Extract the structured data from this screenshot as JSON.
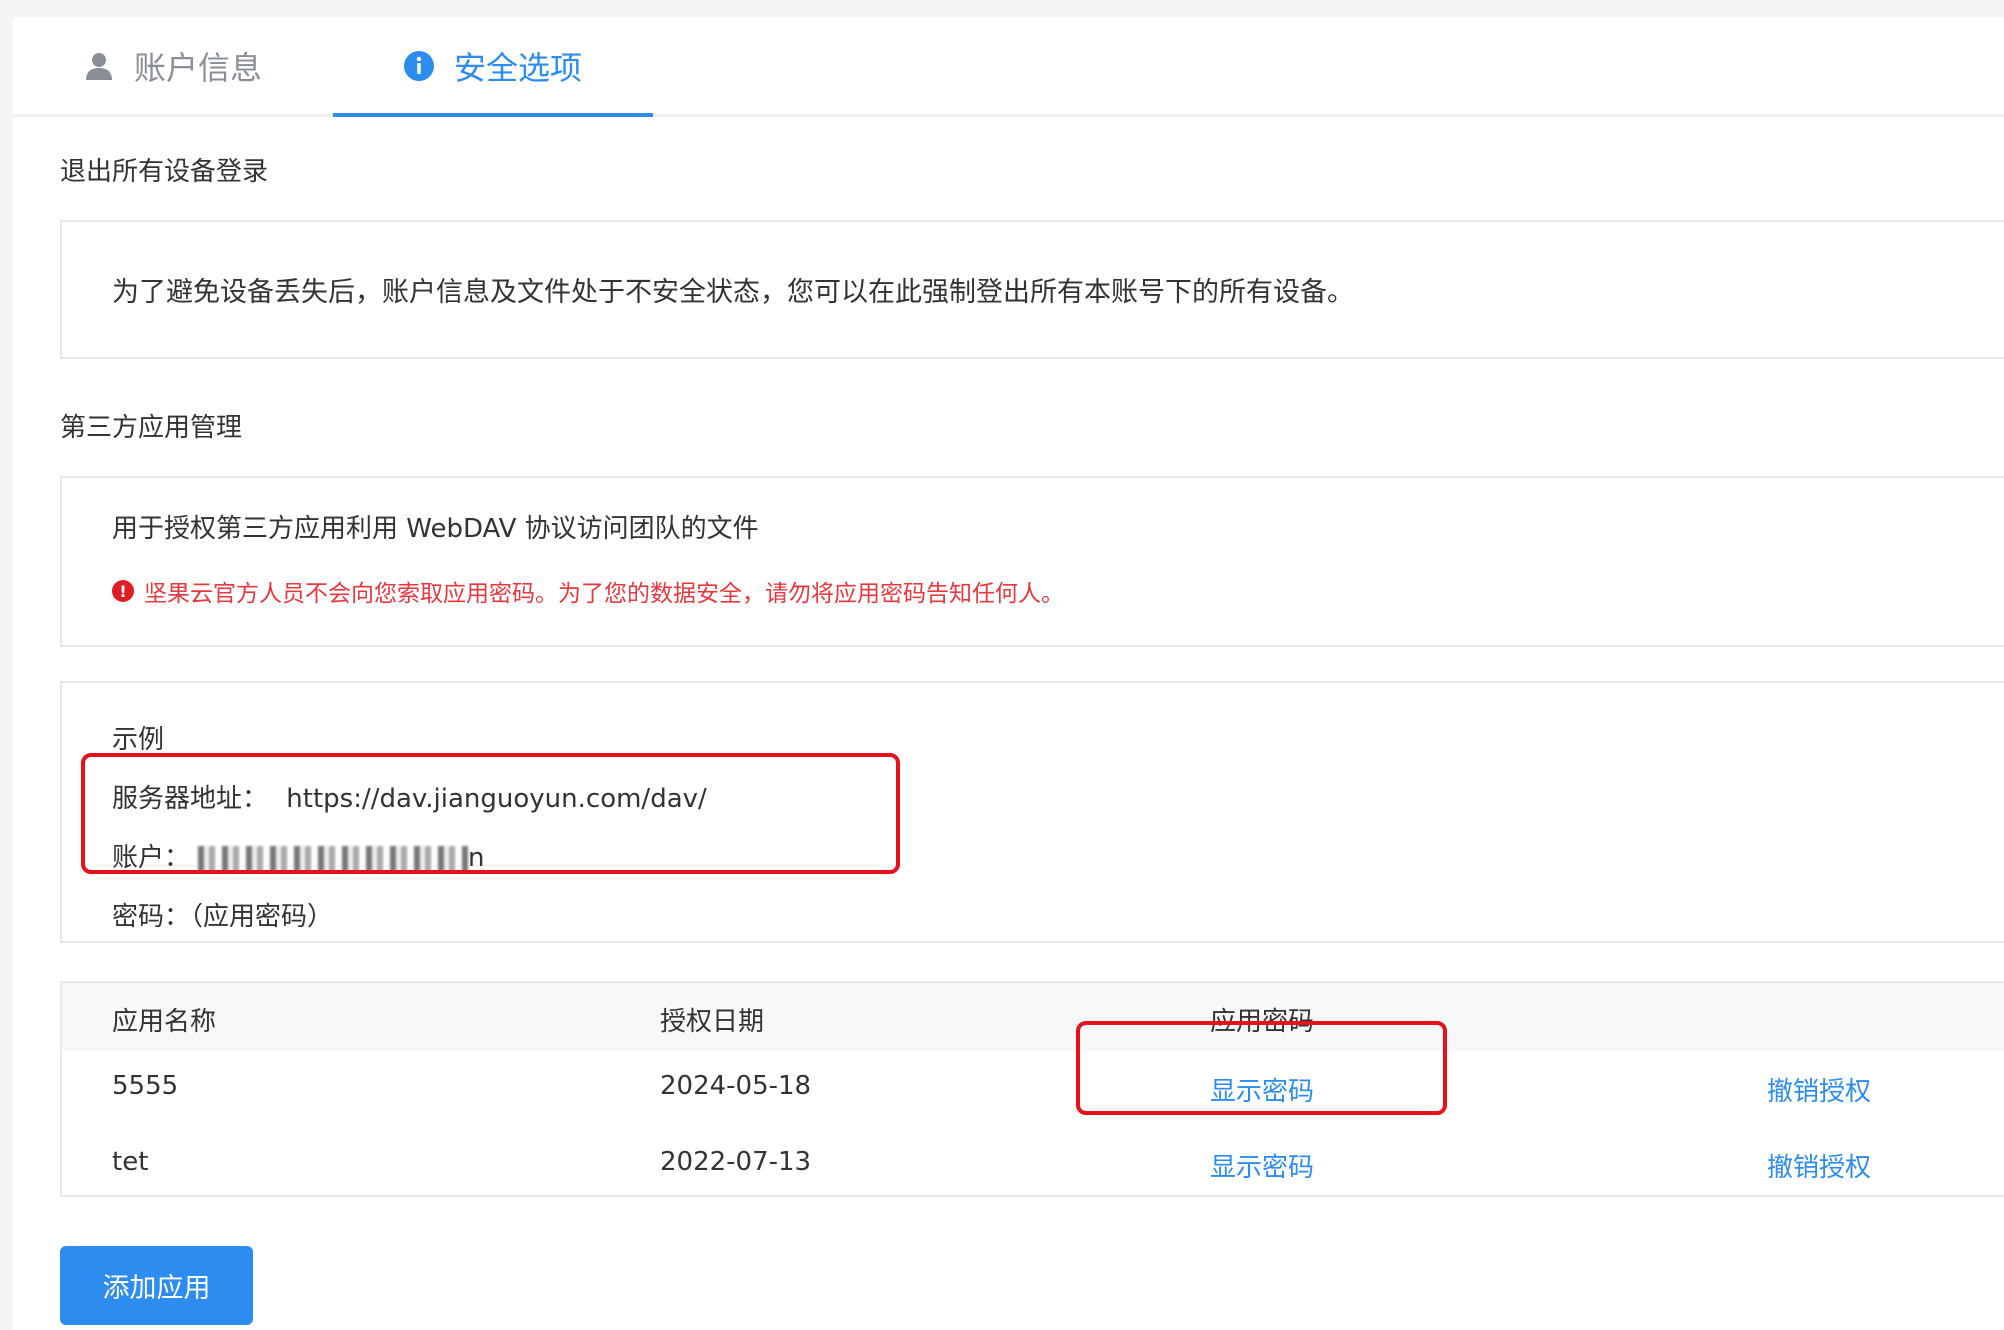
{
  "tabs": {
    "account": {
      "label": "账户信息",
      "icon": "user-icon"
    },
    "security": {
      "label": "安全选项",
      "icon": "info-icon",
      "active": true
    }
  },
  "logout_section": {
    "title": "退出所有设备登录",
    "description": "为了避免设备丢失后，账户信息及文件处于不安全状态，您可以在此强制登出所有本账号下的所有设备。"
  },
  "third_party": {
    "title": "第三方应用管理",
    "description": "用于授权第三方应用利用 WebDAV 协议访问团队的文件",
    "warning": "坚果云官方人员不会向您索取应用密码。为了您的数据安全，请勿将应用密码告知任何人。",
    "warning_icon": "alert-icon"
  },
  "example": {
    "heading": "示例",
    "server_label": "服务器地址：",
    "server_value": "https://dav.jianguoyun.com/dav/",
    "account_label": "账户：",
    "account_tail": "n",
    "password_label": "密码：",
    "password_value": "（应用密码）"
  },
  "table": {
    "headers": {
      "name": "应用名称",
      "date": "授权日期",
      "password": "应用密码"
    },
    "rows": [
      {
        "name": "5555",
        "date": "2024-05-18",
        "show": "显示密码",
        "revoke": "撤销授权"
      },
      {
        "name": "tet",
        "date": "2022-07-13",
        "show": "显示密码",
        "revoke": "撤销授权"
      }
    ]
  },
  "add_button": "添加应用",
  "colors": {
    "accent": "#2d8cf0",
    "warning": "#e8383d",
    "highlight_box": "#e8101c"
  }
}
